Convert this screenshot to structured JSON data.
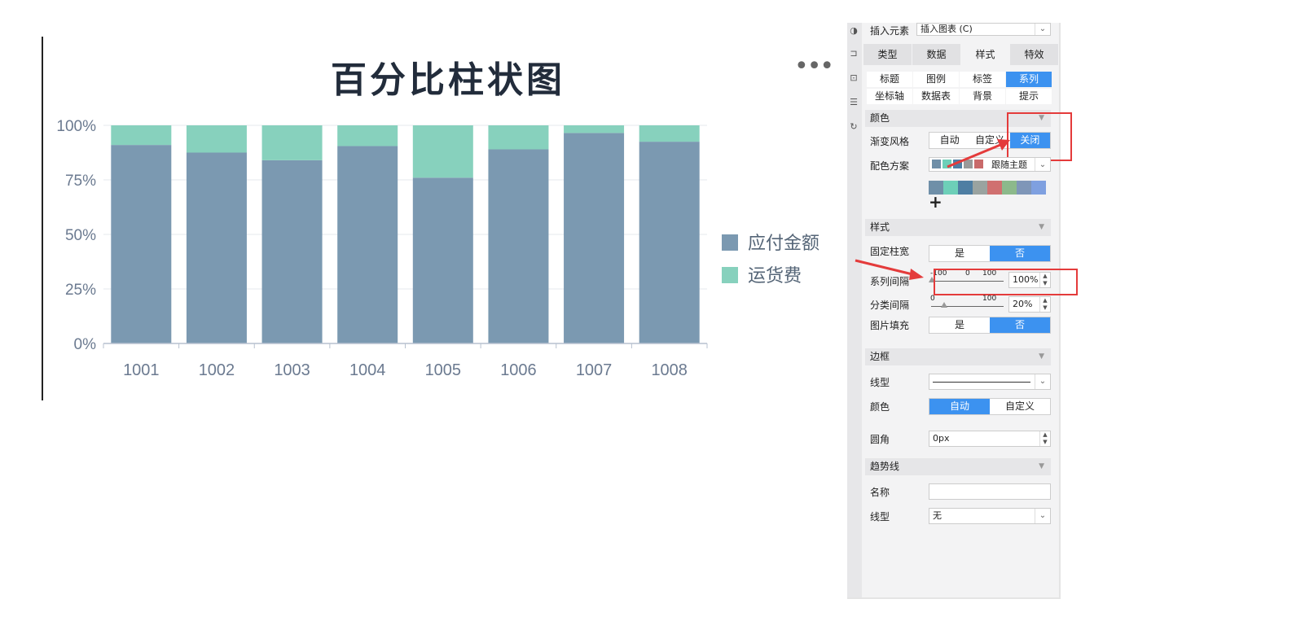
{
  "chart": {
    "title": "百分比柱状图",
    "more": "•••"
  },
  "chart_data": {
    "type": "bar",
    "stacked": "percent",
    "categories": [
      "1001",
      "1002",
      "1003",
      "1004",
      "1005",
      "1006",
      "1007",
      "1008"
    ],
    "series": [
      {
        "name": "应付金额",
        "color": "#7b99b1",
        "values": [
          91,
          87.5,
          84,
          90.5,
          76,
          89,
          96.5,
          92.5
        ]
      },
      {
        "name": "运货费",
        "color": "#87d1bd",
        "values": [
          9,
          12.5,
          16,
          9.5,
          24,
          11,
          3.5,
          7.5
        ]
      }
    ],
    "yticks": [
      "0%",
      "25%",
      "50%",
      "75%",
      "100%"
    ],
    "ylim": [
      0,
      100
    ],
    "legend_position": "right",
    "grid": true
  },
  "panel": {
    "insert_label": "插入元素",
    "insert_value": "插入图表 (C)",
    "tabs": [
      {
        "label": "类型",
        "active": false
      },
      {
        "label": "数据",
        "active": false
      },
      {
        "label": "样式",
        "active": true
      },
      {
        "label": "特效",
        "active": false
      }
    ],
    "subtabs": [
      {
        "label": "标题",
        "active": false
      },
      {
        "label": "图例",
        "active": false
      },
      {
        "label": "标签",
        "active": false
      },
      {
        "label": "系列",
        "active": true
      },
      {
        "label": "坐标轴",
        "active": false
      },
      {
        "label": "数据表",
        "active": false
      },
      {
        "label": "背景",
        "active": false
      },
      {
        "label": "提示",
        "active": false
      }
    ],
    "color_section": "颜色",
    "gradient_label": "渐变风格",
    "gradient_options": [
      "自动",
      "自定义",
      "关闭"
    ],
    "scheme_label": "配色方案",
    "scheme_value": "跟随主题",
    "scheme_colors": [
      "#6f8fa8",
      "#6dcfb8",
      "#4e7ea3",
      "#9a9a9a",
      "#c96a6a"
    ],
    "palette_colors": [
      "#6f8fa8",
      "#6dcfb8",
      "#4e7ea3",
      "#9aa3a0",
      "#d07070",
      "#8cb98b",
      "#7f96b8",
      "#7fa0e0"
    ],
    "add_symbol": "+",
    "style_section": "样式",
    "fixed_width_label": "固定柱宽",
    "yes": "是",
    "no": "否",
    "series_gap_label": "系列间隔",
    "series_gap_ticks": [
      "-100",
      "0",
      "100"
    ],
    "series_gap_value": "100%",
    "category_gap_label": "分类间隔",
    "category_gap_ticks": [
      "0",
      "100"
    ],
    "category_gap_value": "20%",
    "image_fill_label": "图片填充",
    "border_section": "边框",
    "line_type_label": "线型",
    "border_color_label": "颜色",
    "border_color_options": [
      "自动",
      "自定义"
    ],
    "corner_label": "圆角",
    "corner_value": "0px",
    "trend_section": "趋势线",
    "name_label": "名称",
    "name_value": "",
    "trend_line_label": "线型",
    "trend_line_value": "无"
  }
}
